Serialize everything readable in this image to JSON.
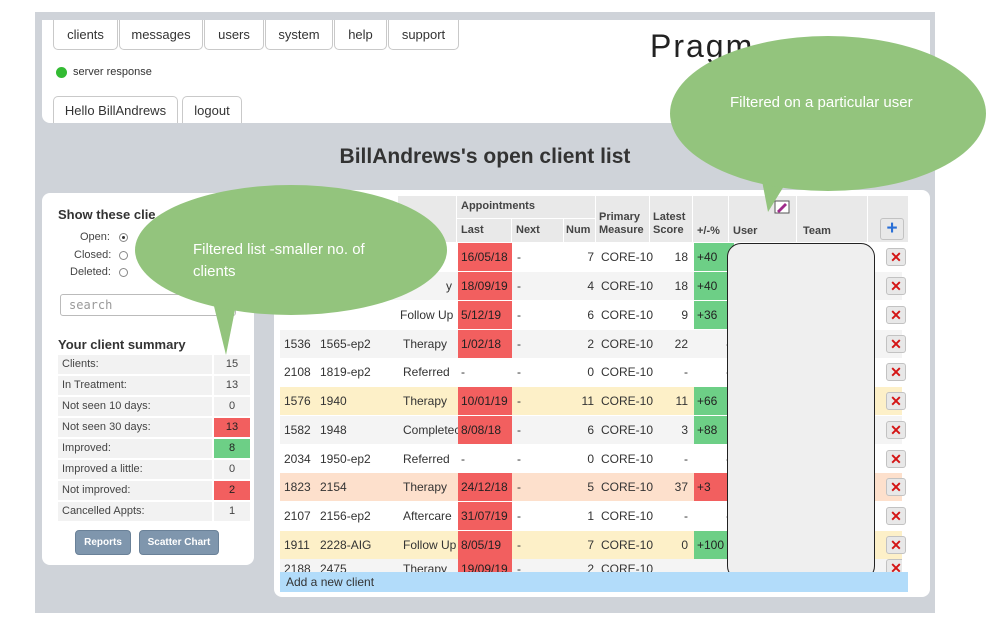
{
  "nav": {
    "tabs": [
      "clients",
      "messages",
      "users",
      "system",
      "help",
      "support"
    ],
    "hello": "Hello BillAndrews",
    "logout": "logout",
    "server_response": "server response",
    "brand": "Pragm"
  },
  "page_title": "BillAndrews's open client list",
  "filter": {
    "heading": "Show these clie",
    "open": "Open:",
    "closed": "Closed:",
    "deleted": "Deleted:",
    "search_placeholder": "search"
  },
  "summary": {
    "title": "Your client summary",
    "rows": [
      {
        "label": "Clients:",
        "value": "15"
      },
      {
        "label": "In Treatment:",
        "value": "13"
      },
      {
        "label": "Not seen 10 days:",
        "value": "0"
      },
      {
        "label": "Not seen 30 days:",
        "value": "13"
      },
      {
        "label": "Improved:",
        "value": "8"
      },
      {
        "label": "Improved a little:",
        "value": "0"
      },
      {
        "label": "Not improved:",
        "value": "2"
      },
      {
        "label": "Cancelled Appts:",
        "value": "1"
      }
    ],
    "reports_button": "Reports",
    "scatter_button": "Scatter Chart"
  },
  "table": {
    "headers": {
      "appointments": "Appointments",
      "last": "Last",
      "next": "Next",
      "num": "Num",
      "primary": "Primary",
      "measure": "Measure",
      "latest": "Latest",
      "score": "Score",
      "pct": "+/-%",
      "user": "User",
      "team": "Team"
    },
    "rows": [
      {
        "id": "",
        "code": "",
        "status": "",
        "last": "16/05/18",
        "next": "-",
        "num": "7",
        "measure": "CORE-10",
        "score": "18",
        "pct": "+40"
      },
      {
        "id": "",
        "code": "",
        "status": "y",
        "last": "18/09/19",
        "next": "-",
        "num": "4",
        "measure": "CORE-10",
        "score": "18",
        "pct": "+40"
      },
      {
        "id": "",
        "code": "",
        "status": "Follow Up",
        "last": "5/12/19",
        "next": "-",
        "num": "6",
        "measure": "CORE-10",
        "score": "9",
        "pct": "+36"
      },
      {
        "id": "1536",
        "code": "1565-ep2",
        "status": "Therapy",
        "last": "1/02/18",
        "next": "-",
        "num": "2",
        "measure": "CORE-10",
        "score": "22",
        "pct": "-"
      },
      {
        "id": "2108",
        "code": "1819-ep2",
        "status": "Referred",
        "last": "-",
        "next": "-",
        "num": "0",
        "measure": "CORE-10",
        "score": "-",
        "pct": "-"
      },
      {
        "id": "1576",
        "code": "1940",
        "status": "Therapy",
        "last": "10/01/19",
        "next": "-",
        "num": "11",
        "measure": "CORE-10",
        "score": "11",
        "pct": "+66"
      },
      {
        "id": "1582",
        "code": "1948",
        "status": "Completec",
        "last": "8/08/18",
        "next": "-",
        "num": "6",
        "measure": "CORE-10",
        "score": "3",
        "pct": "+88"
      },
      {
        "id": "2034",
        "code": "1950-ep2",
        "status": "Referred",
        "last": "-",
        "next": "-",
        "num": "0",
        "measure": "CORE-10",
        "score": "-",
        "pct": "-"
      },
      {
        "id": "1823",
        "code": "2154",
        "status": "Therapy",
        "last": "24/12/18",
        "next": "-",
        "num": "5",
        "measure": "CORE-10",
        "score": "37",
        "pct": "+3"
      },
      {
        "id": "2107",
        "code": "2156-ep2",
        "status": "Aftercare",
        "last": "31/07/19",
        "next": "-",
        "num": "1",
        "measure": "CORE-10",
        "score": "-",
        "pct": "-"
      },
      {
        "id": "1911",
        "code": "2228-AIG",
        "status": "Follow Up",
        "last": "8/05/19",
        "next": "-",
        "num": "7",
        "measure": "CORE-10",
        "score": "0",
        "pct": "+100"
      },
      {
        "id": "2188",
        "code": "2475",
        "status": "Therapy",
        "last": "19/09/19",
        "next": "-",
        "num": "2",
        "measure": "CORE-10",
        "score": "",
        "pct": ""
      }
    ],
    "add_client": "Add a new client"
  },
  "callouts": {
    "left": "Filtered list -smaller no. of clients",
    "right": "Filtered on a particular user"
  },
  "colors": {
    "late": "#f25f5f",
    "improved": "#6dcf86",
    "row_highlight": "#fdf0c8",
    "row_warning": "#fde0cc",
    "callout": "#93c47d",
    "add_bar": "#b2dcfa"
  }
}
